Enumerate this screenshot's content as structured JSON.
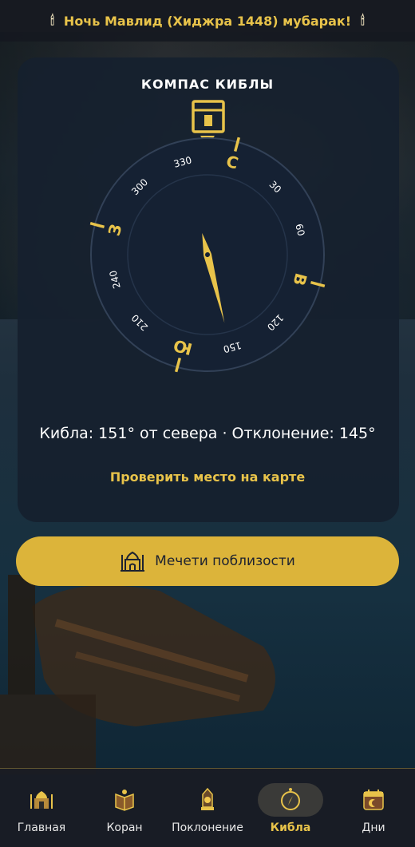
{
  "banner": {
    "text": "Ночь Мавлид (Хиджра 1448) мубарак!",
    "icon_left": "candle-icon",
    "icon_right": "candle-icon"
  },
  "compass": {
    "title": "КОМПАС КИБЛЫ",
    "rotation_deg": 15,
    "needle_deg": 151,
    "cardinals": {
      "north": "С",
      "east": "В",
      "south": "Ю",
      "west": "З"
    },
    "degree_labels": [
      "30",
      "60",
      "120",
      "150",
      "210",
      "240",
      "300",
      "330"
    ],
    "qibla_text": "Кибла: 151° от севера · Отклонение: 145°",
    "map_link": "Проверить место на карте",
    "marker_icon": "kaaba-icon"
  },
  "mosques_button": {
    "label": "Мечети поблизости",
    "icon": "mosque-icon"
  },
  "tabs": [
    {
      "label": "Главная",
      "icon": "home-mosque-icon",
      "active": false
    },
    {
      "label": "Коран",
      "icon": "quran-icon",
      "active": false
    },
    {
      "label": "Поклонение",
      "icon": "lantern-icon",
      "active": false
    },
    {
      "label": "Кибла",
      "icon": "compass-icon",
      "active": true
    },
    {
      "label": "Дни",
      "icon": "calendar-icon",
      "active": false
    }
  ],
  "colors": {
    "accent": "#e8c34a",
    "button": "#dcb43a",
    "card": "#16202e",
    "text": "#ffffff"
  }
}
